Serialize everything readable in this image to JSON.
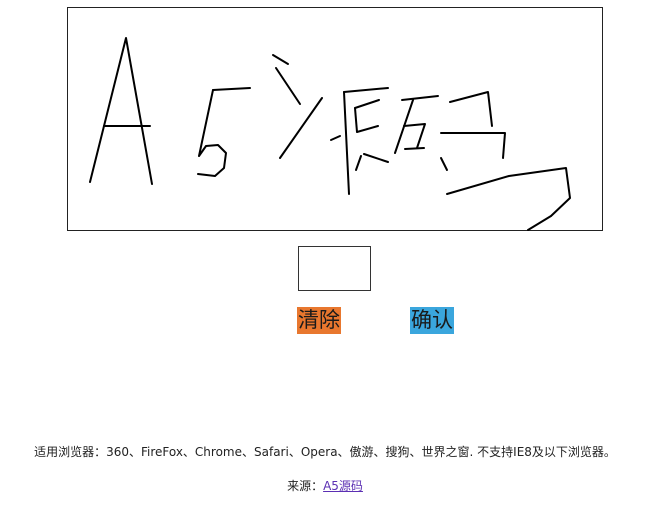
{
  "canvas": {
    "stroke_color": "#000000",
    "strokes": "A5源码 handwriting"
  },
  "buttons": {
    "clear_label": "清除",
    "clear_color": "#e8772e",
    "confirm_label": "确认",
    "confirm_color": "#3aa6dd"
  },
  "footer": {
    "browsers_text": "适用浏览器：360、FireFox、Chrome、Safari、Opera、傲游、搜狗、世界之窗. 不支持IE8及以下浏览器。",
    "source_prefix": "来源：",
    "source_link": "A5源码",
    "link_color": "#5b2fb3"
  }
}
